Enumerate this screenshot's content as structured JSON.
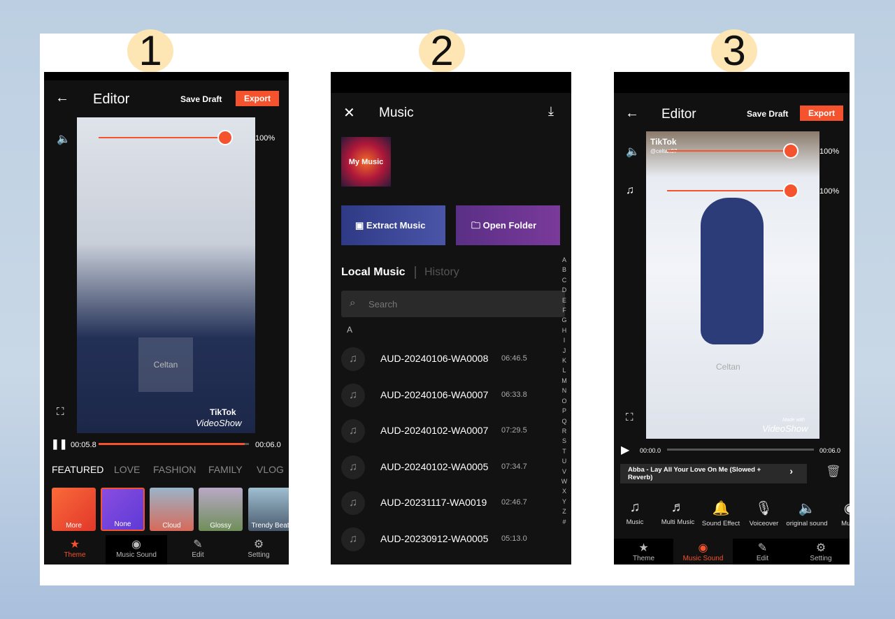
{
  "steps": [
    "1",
    "2",
    "3"
  ],
  "editor1": {
    "title": "Editor",
    "save_draft": "Save Draft",
    "export": "Export",
    "volume": "100%",
    "current_time": "00:05.8",
    "total_time": "00:06.0",
    "progress": 0.97,
    "watermark": "TikTok",
    "brand": "VideoShow",
    "center_wm": "Celtan",
    "categories": [
      "FEATURED",
      "LOVE",
      "FASHION",
      "FAMILY",
      "VLOG"
    ],
    "themes": [
      "More",
      "None",
      "Cloud",
      "Glossy",
      "Trendy Beat"
    ],
    "nav": [
      "Theme",
      "Music Sound",
      "Edit",
      "Setting"
    ],
    "active_nav": "Theme"
  },
  "music": {
    "title": "Music",
    "my_music": "My Music",
    "extract": "Extract Music",
    "open_folder": "Open Folder",
    "tab_local": "Local Music",
    "tab_history": "History",
    "search_placeholder": "Search",
    "section": "A",
    "alphabet": [
      "A",
      "B",
      "C",
      "D",
      "E",
      "F",
      "G",
      "H",
      "I",
      "J",
      "K",
      "L",
      "M",
      "N",
      "O",
      "P",
      "Q",
      "R",
      "S",
      "T",
      "U",
      "V",
      "W",
      "X",
      "Y",
      "Z",
      "#"
    ],
    "items": [
      {
        "name": "AUD-20240106-WA0008",
        "duration": "06:46.5"
      },
      {
        "name": "AUD-20240106-WA0007",
        "duration": "06:33.8"
      },
      {
        "name": "AUD-20240102-WA0007",
        "duration": "07:29.5"
      },
      {
        "name": "AUD-20240102-WA0005",
        "duration": "07:34.7"
      },
      {
        "name": "AUD-20231117-WA0019",
        "duration": "02:46.7"
      },
      {
        "name": "AUD-20230912-WA0005",
        "duration": "05:13.0"
      }
    ]
  },
  "editor3": {
    "title": "Editor",
    "save_draft": "Save Draft",
    "export": "Export",
    "video_volume": "100%",
    "music_volume": "100%",
    "watermark": "TikTok",
    "handle": "@celtan97",
    "made_with": "Made with",
    "brand": "VideoShow",
    "center_wm": "Celtan",
    "current_time": "00:00.0",
    "total_time": "00:06.0",
    "progress": 0.0,
    "track": "Abba - Lay All Your Love On Me (Slowed + Reverb)",
    "tools": [
      "Music",
      "Multi Music",
      "Sound Effect",
      "Voiceover",
      "original sound",
      "Music"
    ],
    "nav": [
      "Theme",
      "Music Sound",
      "Edit",
      "Setting"
    ],
    "active_nav": "Music Sound"
  },
  "colors": {
    "accent": "#f4532d",
    "step_circle": "#fde6b4"
  }
}
